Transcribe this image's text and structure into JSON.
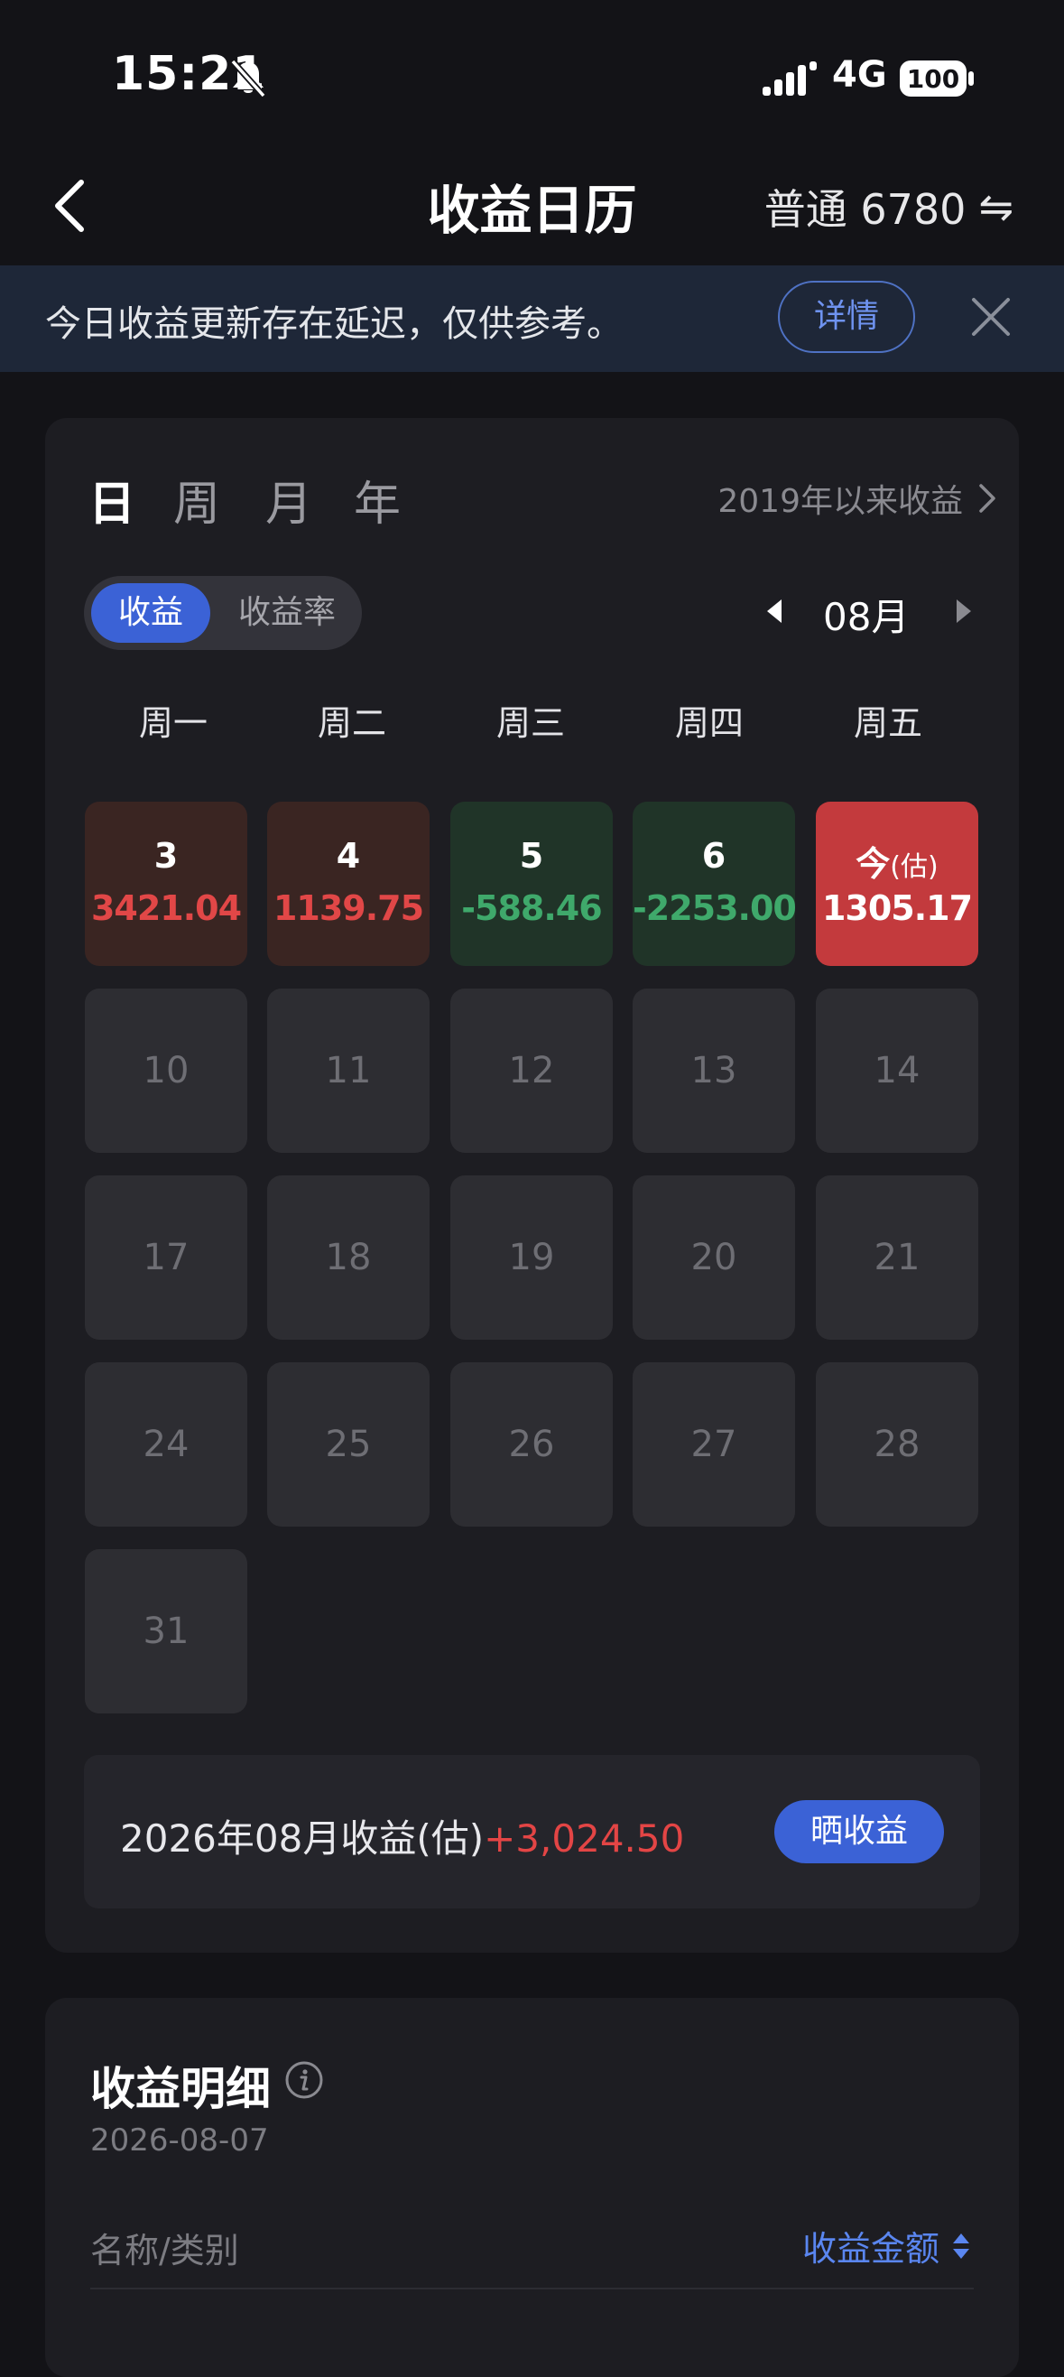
{
  "status_bar": {
    "time": "15:21",
    "network": "4G",
    "battery": "100"
  },
  "header": {
    "title": "收益日历",
    "account": "普通 6780",
    "switch_glyph": "⇋"
  },
  "notice": {
    "text": "今日收益更新存在延迟，仅供参考。",
    "detail_label": "详情"
  },
  "calendar": {
    "period_tabs": [
      "日",
      "周",
      "月",
      "年"
    ],
    "active_period": "日",
    "since_link": "2019年以来收益",
    "toggle": {
      "active": "收益",
      "inactive": "收益率"
    },
    "month": "08月",
    "weekdays": [
      "周一",
      "周二",
      "周三",
      "周四",
      "周五"
    ],
    "days": [
      {
        "label": "3",
        "value": "3421.04",
        "state": "gain"
      },
      {
        "label": "4",
        "value": "1139.75",
        "state": "gain"
      },
      {
        "label": "5",
        "value": "-588.46",
        "state": "loss"
      },
      {
        "label": "6",
        "value": "-2253.00",
        "state": "loss"
      },
      {
        "label": "今",
        "sub": "(估)",
        "value": "1305.17",
        "state": "today"
      },
      {
        "label": "10",
        "state": "empty"
      },
      {
        "label": "11",
        "state": "empty"
      },
      {
        "label": "12",
        "state": "empty"
      },
      {
        "label": "13",
        "state": "empty"
      },
      {
        "label": "14",
        "state": "empty"
      },
      {
        "label": "17",
        "state": "empty"
      },
      {
        "label": "18",
        "state": "empty"
      },
      {
        "label": "19",
        "state": "empty"
      },
      {
        "label": "20",
        "state": "empty"
      },
      {
        "label": "21",
        "state": "empty"
      },
      {
        "label": "24",
        "state": "empty"
      },
      {
        "label": "25",
        "state": "empty"
      },
      {
        "label": "26",
        "state": "empty"
      },
      {
        "label": "27",
        "state": "empty"
      },
      {
        "label": "28",
        "state": "empty"
      },
      {
        "label": "31",
        "state": "empty"
      }
    ],
    "summary": {
      "label": "2026年08月收益(估)",
      "value": "+3,024.50",
      "share_label": "晒收益"
    }
  },
  "detail": {
    "title": "收益明细",
    "date": "2026-08-07",
    "col_name": "名称/类别",
    "col_amount": "收益金额"
  },
  "colors": {
    "accent": "#3b62d6",
    "gain": "#e14747",
    "loss": "#3fa96b",
    "today": "#c33a3d"
  }
}
